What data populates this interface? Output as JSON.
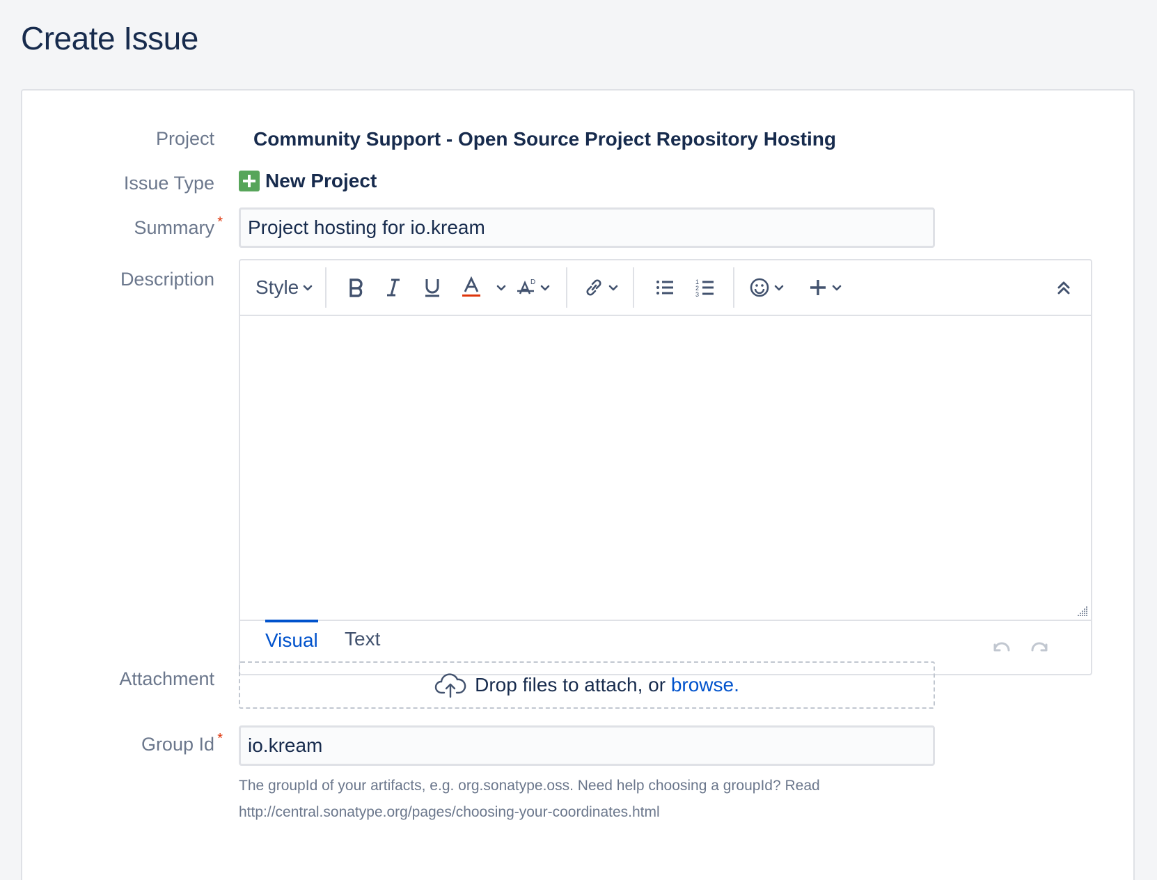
{
  "page": {
    "title": "Create Issue"
  },
  "fields": {
    "project": {
      "label": "Project",
      "value": "Community Support - Open Source Project Repository Hosting"
    },
    "issue_type": {
      "label": "Issue Type",
      "value": "New Project",
      "icon": "plus-square-icon",
      "icon_color": "#57a55a"
    },
    "summary": {
      "label": "Summary",
      "required_marker": "*",
      "value": "Project hosting for io.kream"
    },
    "description": {
      "label": "Description",
      "toolbar": {
        "style_label": "Style",
        "icons": [
          "bold-icon",
          "italic-icon",
          "underline-icon",
          "text-color-icon",
          "text-format-icon",
          "link-icon",
          "bullet-list-icon",
          "numbered-list-icon",
          "emoji-icon",
          "insert-icon",
          "collapse-toolbar-icon"
        ]
      },
      "tabs": {
        "visual": "Visual",
        "text": "Text"
      },
      "active_tab": "Visual"
    },
    "attachment": {
      "label": "Attachment",
      "drop_text": "Drop files to attach, or ",
      "browse_text": "browse."
    },
    "group_id": {
      "label": "Group Id",
      "required_marker": "*",
      "value": "io.kream",
      "help_line1": "The groupId of your artifacts, e.g. org.sonatype.oss. Need help choosing a groupId? Read",
      "help_line2": "http://central.sonatype.org/pages/choosing-your-coordinates.html"
    }
  },
  "colors": {
    "accent": "#0052cc",
    "required": "#de350b",
    "text_color_underline": "#de350b"
  }
}
